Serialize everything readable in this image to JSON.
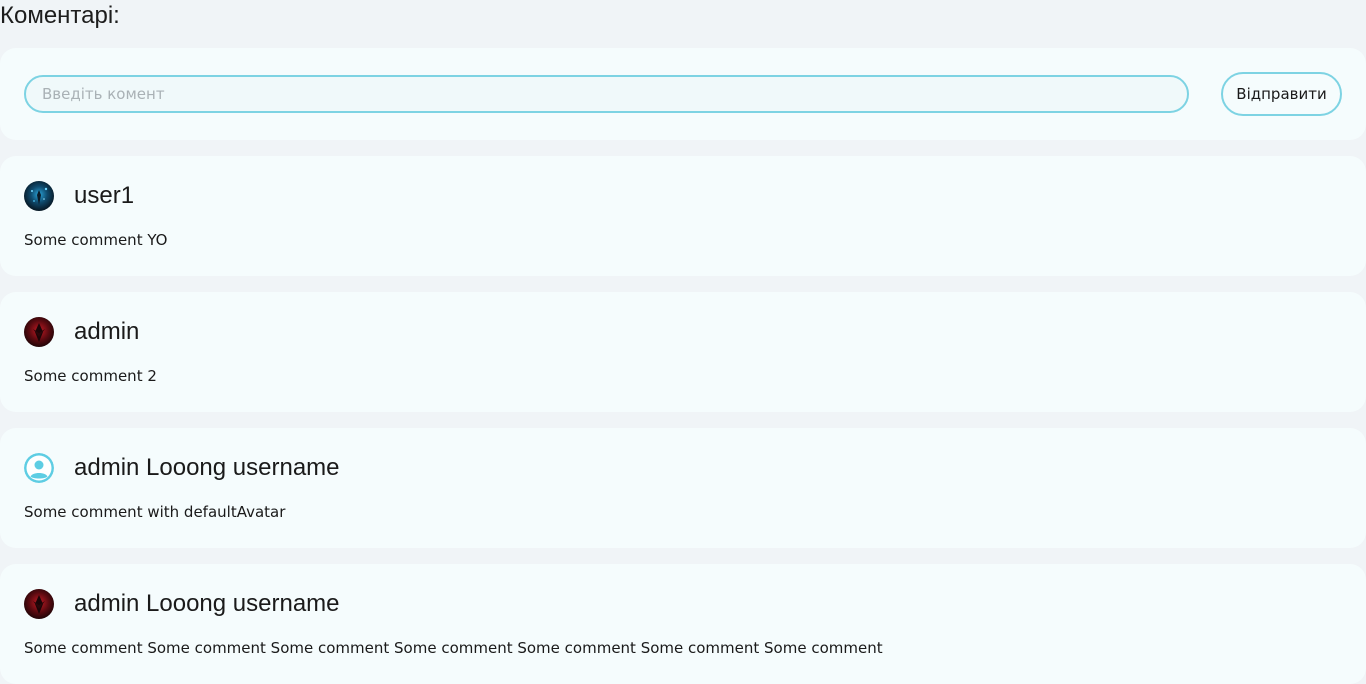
{
  "heading": "Коментарі:",
  "comment_form": {
    "input_value": "",
    "input_placeholder": "Введіть комент",
    "send_label": "Відправити"
  },
  "comments": [
    {
      "username": "user1",
      "text": "Some comment YO",
      "avatar": "blue-dark-image-avatar"
    },
    {
      "username": "admin",
      "text": "Some comment 2",
      "avatar": "red-dark-image-avatar"
    },
    {
      "username": "admin Looong username",
      "text": "Some comment with defaultAvatar",
      "avatar": "default-user-icon"
    },
    {
      "username": "admin Looong username",
      "text": "Some comment Some comment Some comment Some comment Some comment Some comment Some comment",
      "avatar": "red-dark-image-avatar"
    }
  ],
  "colors": {
    "background": "#f0f4f7",
    "card": "#f5fcfd",
    "accent": "#7dd3e3",
    "default_avatar": "#5ecde3"
  }
}
